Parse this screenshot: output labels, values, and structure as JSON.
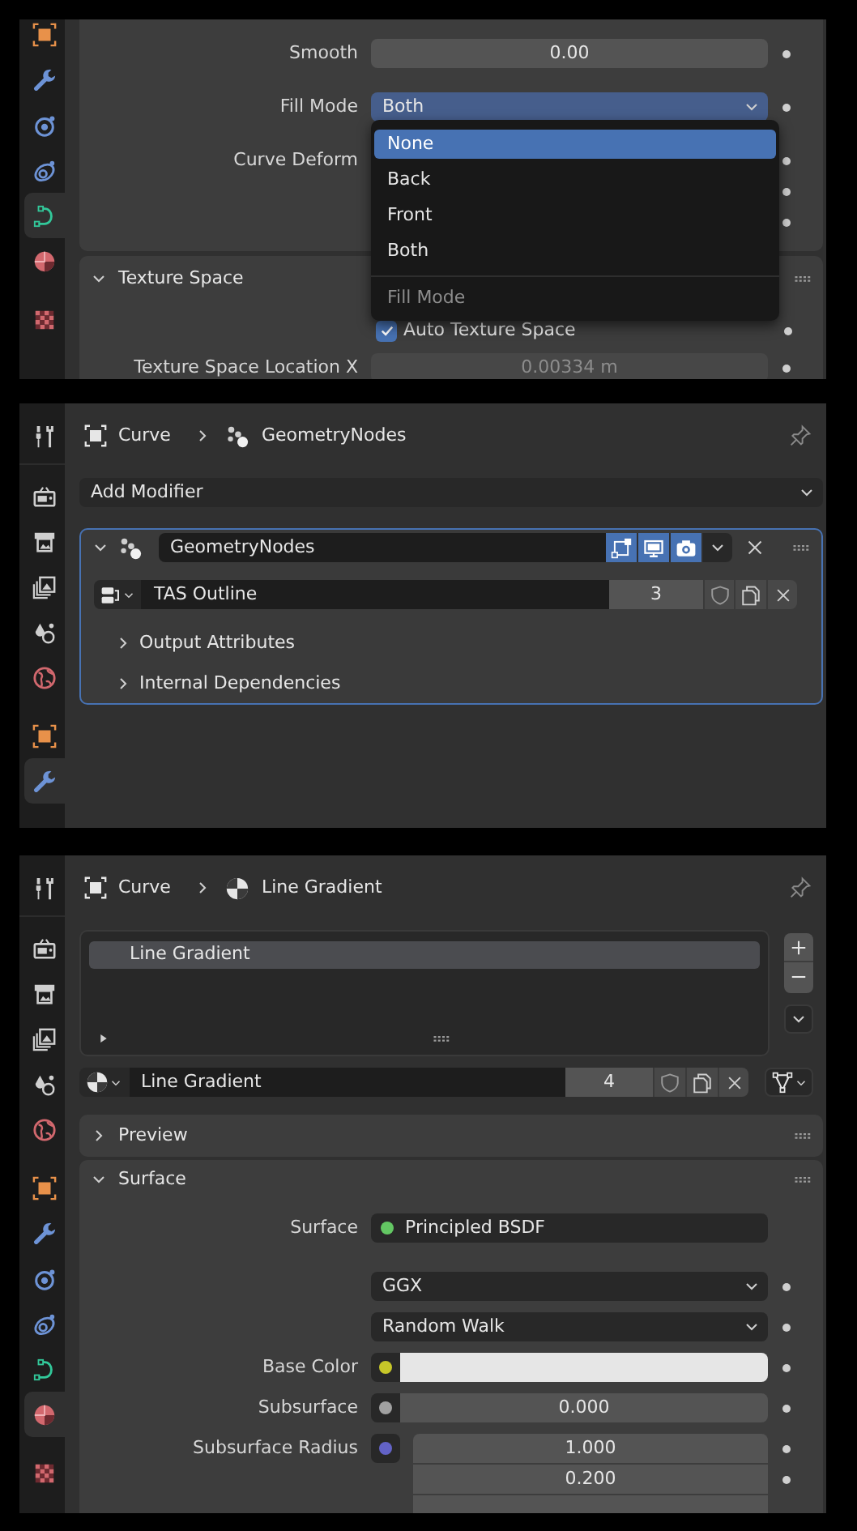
{
  "curve_panel": {
    "sidebar": [
      {
        "kind": "object",
        "selected": false
      },
      {
        "kind": "modifier",
        "selected": false
      },
      {
        "kind": "particles",
        "selected": false
      },
      {
        "kind": "physics",
        "selected": false
      },
      {
        "kind": "curve_data",
        "selected": true
      },
      {
        "kind": "material",
        "selected": false
      },
      {
        "kind": "texture",
        "selected": false
      }
    ],
    "rows": [
      {
        "kind": "number",
        "label": "Smooth",
        "value": "0.00"
      },
      {
        "kind": "dropdown",
        "label": "Fill Mode",
        "value": "Both",
        "expanded": true
      },
      {
        "kind": "heading",
        "label": "Curve Deform"
      }
    ],
    "fill_mode_menu": {
      "items": [
        {
          "label": "None",
          "selected": true
        },
        {
          "label": "Back",
          "selected": false
        },
        {
          "label": "Front",
          "selected": false
        },
        {
          "label": "Both",
          "selected": false
        }
      ],
      "title": "Fill Mode"
    },
    "texture_space": {
      "title": "Texture Space",
      "expanded": true,
      "auto_texture_space": {
        "label": "Auto Texture Space",
        "checked": true
      },
      "location_x": {
        "label": "Texture Space Location X",
        "value": "0.00334 m",
        "disabled": true
      }
    }
  },
  "modifier_panel": {
    "sidebar": [
      {
        "kind": "tool",
        "selected": false
      },
      {
        "kind": "render",
        "selected": false
      },
      {
        "kind": "output",
        "selected": false
      },
      {
        "kind": "view_layer",
        "selected": false
      },
      {
        "kind": "scene",
        "selected": false
      },
      {
        "kind": "world",
        "selected": false
      },
      {
        "kind": "object",
        "selected": false
      },
      {
        "kind": "modifier",
        "selected": true
      }
    ],
    "breadcrumb": [
      {
        "kind": "object",
        "label": "Curve"
      },
      {
        "kind": "nodes",
        "label": "GeometryNodes"
      }
    ],
    "add_modifier": "Add Modifier",
    "modifier": {
      "name": "GeometryNodes",
      "expanded": true,
      "toggles": [
        {
          "kind": "edit_mode",
          "on": true
        },
        {
          "kind": "viewport",
          "on": true
        },
        {
          "kind": "camera",
          "on": true
        }
      ],
      "node_group": {
        "name": "TAS Outline",
        "users": "3"
      },
      "subpanels": [
        {
          "title": "Output Attributes",
          "expanded": false
        },
        {
          "title": "Internal Dependencies",
          "expanded": false
        }
      ]
    }
  },
  "material_panel": {
    "sidebar": [
      {
        "kind": "tool",
        "selected": false
      },
      {
        "kind": "render",
        "selected": false
      },
      {
        "kind": "output",
        "selected": false
      },
      {
        "kind": "view_layer",
        "selected": false
      },
      {
        "kind": "scene",
        "selected": false
      },
      {
        "kind": "world",
        "selected": false
      },
      {
        "kind": "object",
        "selected": false
      },
      {
        "kind": "modifier",
        "selected": false
      },
      {
        "kind": "particles",
        "selected": false
      },
      {
        "kind": "physics",
        "selected": false
      },
      {
        "kind": "curve_data",
        "selected": false
      },
      {
        "kind": "material",
        "selected": true
      },
      {
        "kind": "texture",
        "selected": false
      }
    ],
    "breadcrumb": [
      {
        "kind": "object",
        "label": "Curve"
      },
      {
        "kind": "material",
        "label": "Line Gradient"
      }
    ],
    "slots": [
      {
        "label": "Line Gradient",
        "selected": true
      }
    ],
    "material": {
      "name": "Line Gradient",
      "users": "4"
    },
    "preview": {
      "title": "Preview",
      "expanded": false
    },
    "surface": {
      "title": "Surface",
      "expanded": true,
      "rows": [
        {
          "kind": "shader",
          "label": "Surface",
          "value": "Principled BSDF",
          "color": "#63c763"
        },
        {
          "kind": "dropdown",
          "value": "GGX"
        },
        {
          "kind": "dropdown",
          "value": "Random Walk"
        },
        {
          "kind": "color",
          "label": "Base Color",
          "color": "#c7c729"
        },
        {
          "kind": "number",
          "label": "Subsurface",
          "value": "0.000",
          "color": "#a1a1a1"
        },
        {
          "kind": "vector",
          "label": "Subsurface Radius",
          "values": [
            "1.000",
            "0.200"
          ],
          "color": "#6363c7"
        }
      ]
    }
  }
}
